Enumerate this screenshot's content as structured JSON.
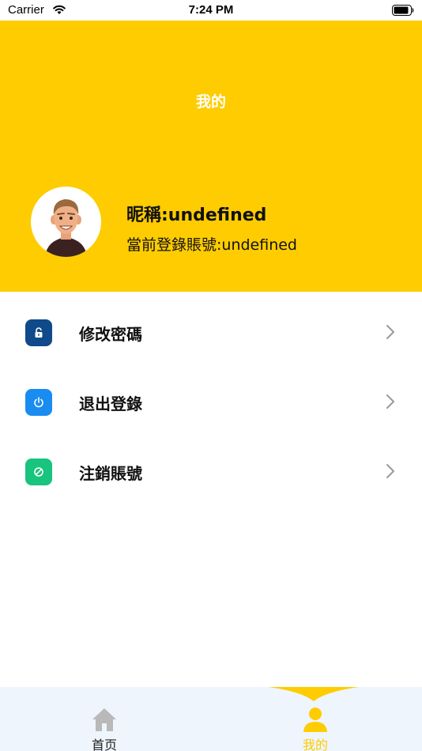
{
  "status_bar": {
    "carrier": "Carrier",
    "time": "7:24 PM"
  },
  "header": {
    "title": "我的",
    "nickname": "昵稱:undefined",
    "account": "當前登錄賬號:undefined",
    "background_color": "#fecc00"
  },
  "menu": {
    "items": [
      {
        "label": "修改密碼",
        "icon": "unlock-icon",
        "icon_color": "#0f4a8a"
      },
      {
        "label": "退出登錄",
        "icon": "power-icon",
        "icon_color": "#1a8cf0"
      },
      {
        "label": "注銷賬號",
        "icon": "ban-icon",
        "icon_color": "#18c47e"
      }
    ]
  },
  "tab_bar": {
    "tabs": [
      {
        "label": "首页",
        "icon": "home-icon",
        "active": false,
        "color": "#222222"
      },
      {
        "label": "我的",
        "icon": "user-icon",
        "active": true,
        "color": "#fecc00"
      }
    ]
  }
}
